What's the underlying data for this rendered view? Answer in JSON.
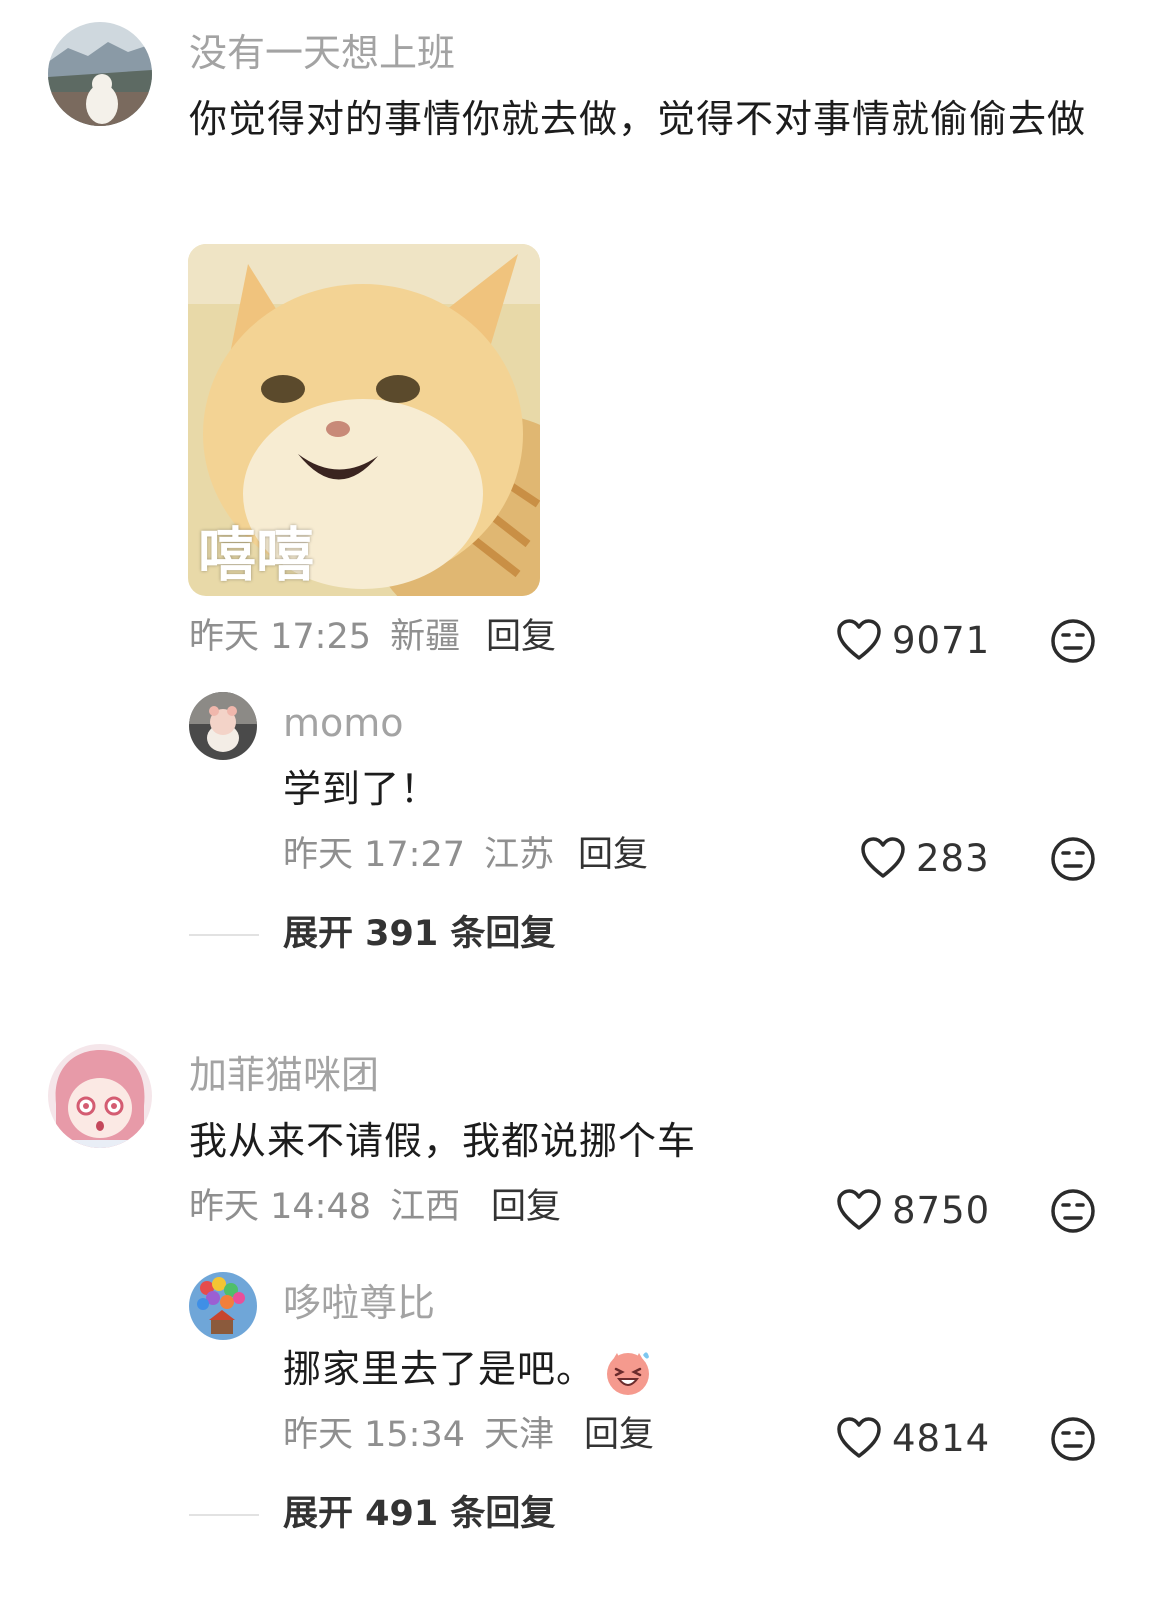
{
  "comments": [
    {
      "username": "没有一天想上班",
      "text": "你觉得对的事情你就去做，觉得不对事情就偷偷去做",
      "sticker_caption": "嘻嘻",
      "time": "昨天 17:25",
      "location": "新疆",
      "reply_label": "回复",
      "likes": "9071",
      "replies": [
        {
          "username": "momo",
          "text": "学到了！",
          "time": "昨天 17:27",
          "location": "江苏",
          "reply_label": "回复",
          "likes": "283"
        }
      ],
      "expand_label": "展开 391 条回复"
    },
    {
      "username": "加菲猫咪团",
      "text": "我从来不请假，我都说挪个车",
      "time": "昨天 14:48",
      "location": "江西",
      "reply_label": "回复",
      "likes": "8750",
      "replies": [
        {
          "username": "哆啦尊比",
          "text": "挪家里去了是吧。",
          "time": "昨天 15:34",
          "location": "天津",
          "reply_label": "回复",
          "likes": "4814"
        }
      ],
      "expand_label": "展开 491 条回复"
    }
  ],
  "icons": {
    "like": "heart-outline-icon",
    "dislike": "meh-face-icon"
  },
  "colors": {
    "username": "#a3a3a3",
    "meta": "#8f8f8f",
    "text": "#1c1c1c"
  }
}
